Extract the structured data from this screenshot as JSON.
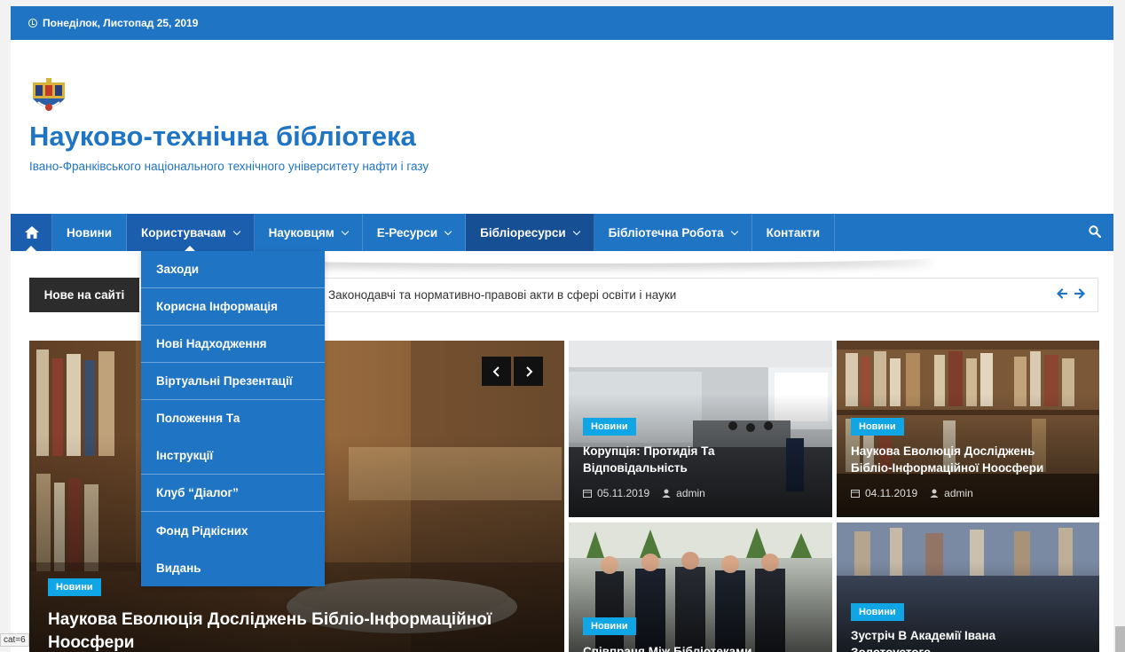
{
  "topbar": {
    "date": "Понеділок, Листопад 25, 2019"
  },
  "brand": {
    "title": "Науково-технічна бібліотека",
    "subtitle": "Івано-Франківського національного технічного університету нафти і газу"
  },
  "nav": {
    "items": [
      {
        "label": "Новини",
        "has_dropdown": false
      },
      {
        "label": "Користувачам",
        "has_dropdown": true
      },
      {
        "label": "Науковцям",
        "has_dropdown": true
      },
      {
        "label": "Е-Ресурси",
        "has_dropdown": true
      },
      {
        "label": "Бібліоресурси",
        "has_dropdown": true
      },
      {
        "label": "Бібліотечна Робота",
        "has_dropdown": true
      },
      {
        "label": "Контакти",
        "has_dropdown": false
      }
    ]
  },
  "dropdown": {
    "items": [
      {
        "label": "Заходи"
      },
      {
        "label": "Корисна Інформація"
      },
      {
        "label": "Нові Надходження"
      },
      {
        "label": "Віртуальні Презентації"
      },
      {
        "label_line1": "Положення Та",
        "label_line2": "Інструкції"
      },
      {
        "label": "Клуб “Діалог”"
      },
      {
        "label_line1": "Фонд Рідкісних",
        "label_line2": "Видань"
      }
    ]
  },
  "ticker": {
    "label": "Нове на сайті",
    "text": "Законодавчі та нормативно-правові акти в сфері освіти і науки"
  },
  "featured": {
    "badge": "Новини",
    "title_line1": "Наукова Еволюція Досліджень Бібліо-Інформаційної",
    "title_line2": "Ноосфери"
  },
  "tiles": [
    {
      "badge": "Новини",
      "title_line1": "Корупція: Протидія Та",
      "title_line2": "Відповідальність",
      "date": "05.11.2019",
      "author": "admin"
    },
    {
      "badge": "Новини",
      "title_line1": "Наукова Еволюція Досліджень",
      "title_line2": "Бібліо-Інформаційної Ноосфери",
      "date": "04.11.2019",
      "author": "admin"
    },
    {
      "badge": "Новини",
      "title_line1": "Співпраця Між Бібліотеками",
      "title_line2": ""
    },
    {
      "badge": "Новини",
      "title_line1": "Зустріч В Академії Івана",
      "title_line2": "Золотоустого"
    }
  ],
  "status": {
    "url_tip": "cat=6"
  },
  "colors": {
    "primary": "#1f74c4",
    "badge": "#10a6e6",
    "dark": "#2c2c2c"
  }
}
